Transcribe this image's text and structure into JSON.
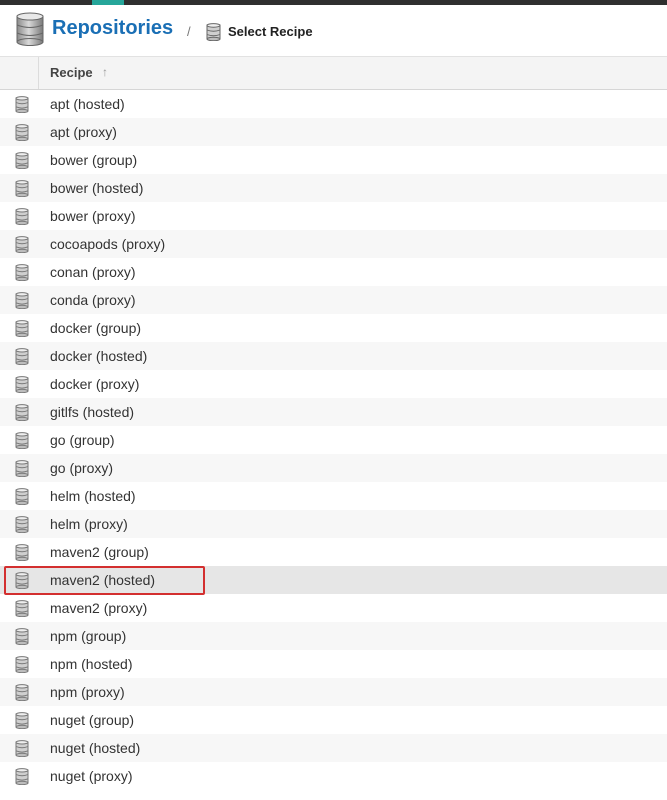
{
  "header": {
    "title": "Repositories",
    "separator": "/",
    "breadcrumb": "Select Recipe",
    "icon": "database-icon"
  },
  "grid": {
    "column_header": "Recipe",
    "sort_indicator": "↑",
    "row_icon": "database-icon",
    "selected_row": "maven2 (hosted)",
    "rows": [
      "apt (hosted)",
      "apt (proxy)",
      "bower (group)",
      "bower (hosted)",
      "bower (proxy)",
      "cocoapods (proxy)",
      "conan (proxy)",
      "conda (proxy)",
      "docker (group)",
      "docker (hosted)",
      "docker (proxy)",
      "gitlfs (hosted)",
      "go (group)",
      "go (proxy)",
      "helm (hosted)",
      "helm (proxy)",
      "maven2 (group)",
      "maven2 (hosted)",
      "maven2 (proxy)",
      "npm (group)",
      "npm (hosted)",
      "npm (proxy)",
      "nuget (group)",
      "nuget (hosted)",
      "nuget (proxy)"
    ]
  },
  "colors": {
    "title": "#1a6fb5",
    "highlight": "#d32f2f",
    "selected_row_bg": "#e6e6e6"
  }
}
